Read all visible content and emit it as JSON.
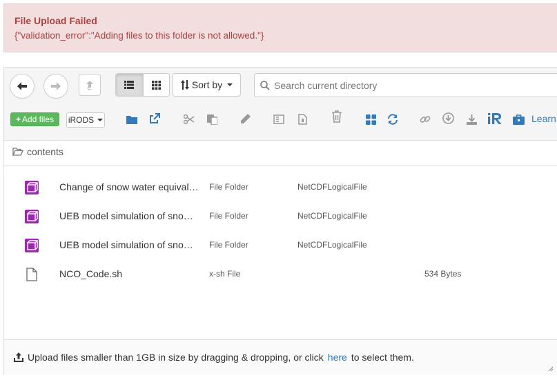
{
  "alert": {
    "title": "File Upload Failed",
    "message": "{\"validation_error\":\"Adding files to this folder is not allowed.\"}"
  },
  "toolbar": {
    "sort_label": "Sort by",
    "search_placeholder": "Search current directory",
    "add_files_label": "Add files",
    "irods_label": "iRODS",
    "learn_label": "Learn"
  },
  "breadcrumb": {
    "label": "contents"
  },
  "files": [
    {
      "name": "Change of snow water equivalent",
      "type": "File Folder",
      "meta": "NetCDFLogicalFile",
      "size": "",
      "icon": "netcdf-icon"
    },
    {
      "name": "UEB model simulation of snow water equivalent",
      "type": "File Folder",
      "meta": "NetCDFLogicalFile",
      "size": "",
      "icon": "netcdf-icon"
    },
    {
      "name": "UEB model simulation of snow melt",
      "type": "File Folder",
      "meta": "NetCDFLogicalFile",
      "size": "",
      "icon": "netcdf-icon"
    },
    {
      "name": "NCO_Code.sh",
      "type": "x-sh File",
      "meta": "",
      "size": "534 Bytes",
      "icon": "file-icon"
    }
  ],
  "upload": {
    "text_before": "Upload files smaller than 1GB in size by dragging & dropping, or click",
    "link": "here",
    "text_after": "to select them."
  },
  "colors": {
    "alert_bg": "#f2dede",
    "alert_text": "#a94442",
    "primary": "#337ab7",
    "success": "#5cb85c",
    "netcdf": "#9c27b0"
  }
}
